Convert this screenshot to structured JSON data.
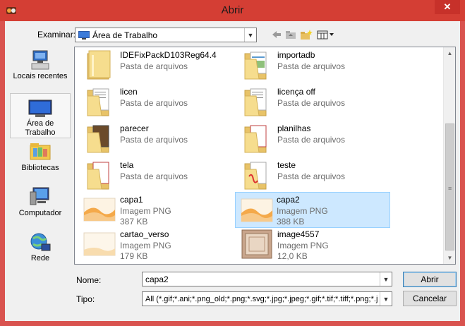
{
  "window": {
    "title": "Abrir",
    "close_glyph": "✕"
  },
  "lookin": {
    "label": "Examinar:",
    "value": "Área de Trabalho"
  },
  "toolbar": {
    "icons": [
      "back-arrow-icon",
      "up-folder-icon",
      "new-folder-icon",
      "view-menu-icon"
    ]
  },
  "places": [
    {
      "label": "Locais recentes",
      "icon": "recent-places-icon"
    },
    {
      "label": "Área de Trabalho",
      "icon": "desktop-icon",
      "selected": true
    },
    {
      "label": "Bibliotecas",
      "icon": "libraries-icon"
    },
    {
      "label": "Computador",
      "icon": "computer-icon"
    },
    {
      "label": "Rede",
      "icon": "network-icon"
    }
  ],
  "files": [
    {
      "name": "IDEFixPackD103Reg64.4",
      "kind": "Pasta de arquivos",
      "size": "",
      "type": "folder"
    },
    {
      "name": "importadb",
      "kind": "Pasta de arquivos",
      "size": "",
      "type": "folder-doc"
    },
    {
      "name": "licen",
      "kind": "Pasta de arquivos",
      "size": "",
      "type": "folder-doc"
    },
    {
      "name": "licença off",
      "kind": "Pasta de arquivos",
      "size": "",
      "type": "folder-doc"
    },
    {
      "name": "parecer",
      "kind": "Pasta de arquivos",
      "size": "",
      "type": "folder-doc"
    },
    {
      "name": "planilhas",
      "kind": "Pasta de arquivos",
      "size": "",
      "type": "folder-doc"
    },
    {
      "name": "tela",
      "kind": "Pasta de arquivos",
      "size": "",
      "type": "folder-doc"
    },
    {
      "name": "teste",
      "kind": "Pasta de arquivos",
      "size": "",
      "type": "folder-pdf"
    },
    {
      "name": "capa1",
      "kind": "Imagem PNG",
      "size": "387 KB",
      "type": "image-orange"
    },
    {
      "name": "capa2",
      "kind": "Imagem PNG",
      "size": "388 KB",
      "type": "image-orange",
      "selected": true
    },
    {
      "name": "cartao_verso",
      "kind": "Imagem PNG",
      "size": "179 KB",
      "type": "image-light"
    },
    {
      "name": "image4557",
      "kind": "Imagem PNG",
      "size": "12,0 KB",
      "type": "image-frame"
    }
  ],
  "filename": {
    "label": "Nome:",
    "value": "capa2"
  },
  "filetype": {
    "label": "Tipo:",
    "value": "All (*.gif;*.ani;*.png_old;*.png;*.svg;*.jpg;*.jpeg;*.gif;*.tif;*.tiff;*.png;*.jpg;"
  },
  "buttons": {
    "open": "Abrir",
    "cancel": "Cancelar"
  },
  "colors": {
    "titlebar": "#d43e34",
    "selection": "#cde8ff",
    "folder": "#f3d27a"
  }
}
